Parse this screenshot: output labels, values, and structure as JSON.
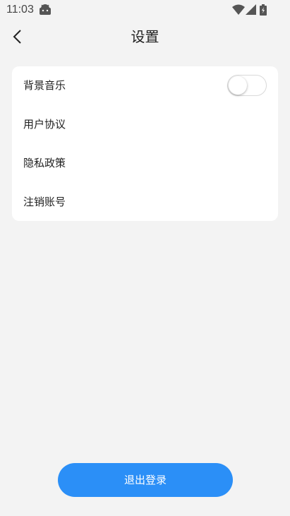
{
  "status_bar": {
    "time": "11:03",
    "app_icon": "android-robot-icon",
    "wifi_icon": "wifi-icon",
    "signal_icon": "cell-signal-icon",
    "battery_icon": "battery-charging-icon"
  },
  "header": {
    "back_icon": "chevron-left-icon",
    "title": "设置"
  },
  "settings": {
    "items": [
      {
        "label": "背景音乐",
        "control": "toggle",
        "toggle_on": false
      },
      {
        "label": "用户协议"
      },
      {
        "label": "隐私政策"
      },
      {
        "label": "注销账号"
      }
    ]
  },
  "logout": {
    "label": "退出登录"
  },
  "colors": {
    "background": "#f3f3f3",
    "card": "#ffffff",
    "accent": "#2b8ff7",
    "text": "#222222"
  }
}
